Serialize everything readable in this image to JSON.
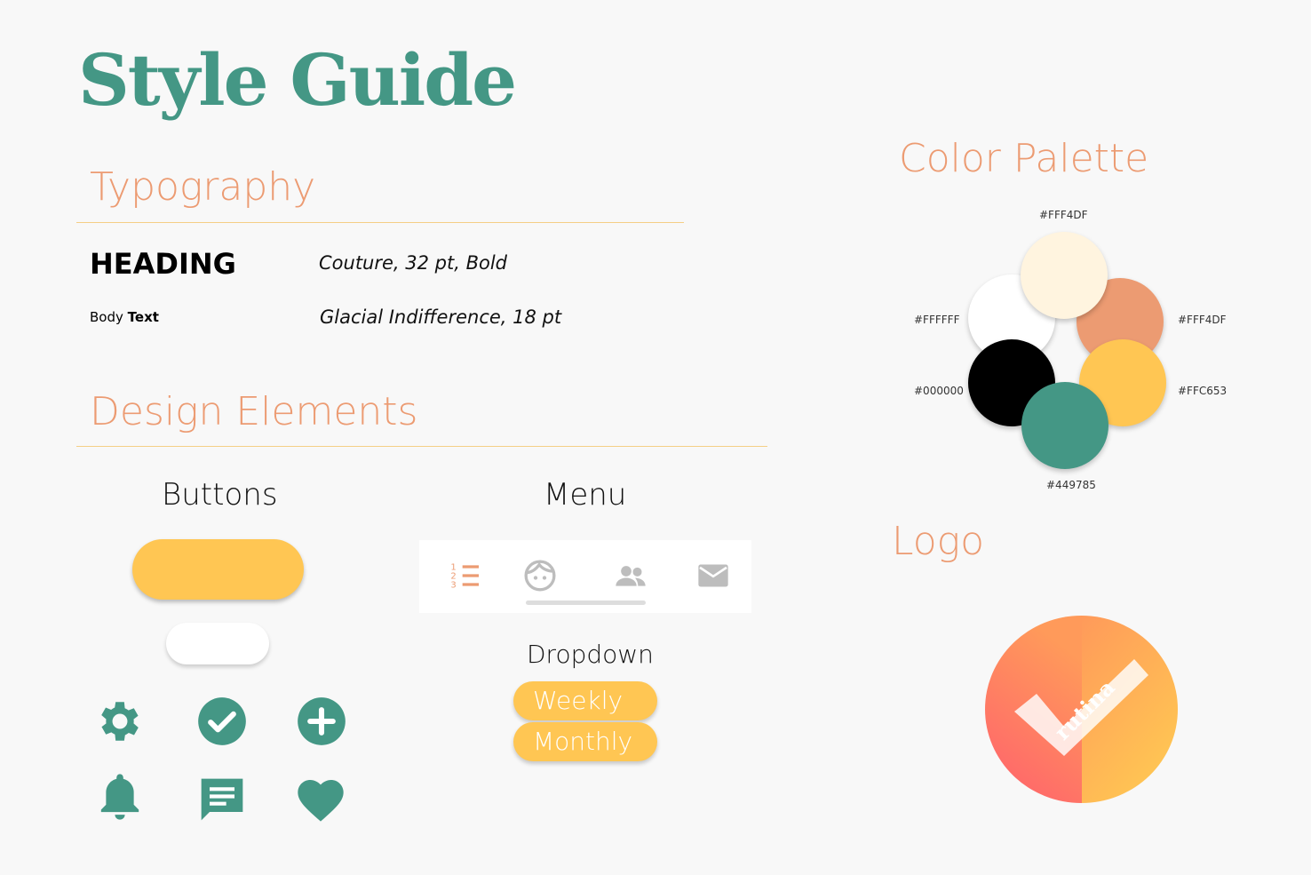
{
  "title": "Style Guide",
  "colors": {
    "title": "#449785",
    "section": "#ec9b72",
    "button": "#ffc653",
    "icon": "#449785",
    "menu_active": "#ec9b72",
    "menu_inactive": "#bdbdbd"
  },
  "typography": {
    "section_title": "Typography",
    "heading_sample": "HEADING",
    "heading_spec": "Couture, 32 pt, Bold",
    "body_sample_regular": "Body",
    "body_sample_bold": "Text",
    "body_spec": "Glacial Indifference, 18 pt"
  },
  "design_elements": {
    "section_title": "Design Elements",
    "buttons_title": "Buttons",
    "menu_title": "Menu",
    "dropdown_title": "Dropdown",
    "dropdown_options": [
      "Weekly",
      "Monthly"
    ],
    "icons": [
      "gear-icon",
      "check-circle-icon",
      "plus-circle-icon",
      "bell-icon",
      "chat-icon",
      "heart-icon"
    ],
    "menu_icons": [
      "list-icon",
      "face-icon",
      "people-icon",
      "mail-icon"
    ]
  },
  "palette": {
    "section_title": "Color Palette",
    "swatches": [
      {
        "label": "#FFF4DF",
        "color": "#fff4df"
      },
      {
        "label": "#FFF4DF",
        "color": "#ec9b72"
      },
      {
        "label": "#FFC653",
        "color": "#ffc653"
      },
      {
        "label": "#449785",
        "color": "#449785"
      },
      {
        "label": "#000000",
        "color": "#000000"
      },
      {
        "label": "#FFFFFF",
        "color": "#ffffff"
      }
    ]
  },
  "logo": {
    "section_title": "Logo",
    "text": "rutina"
  }
}
